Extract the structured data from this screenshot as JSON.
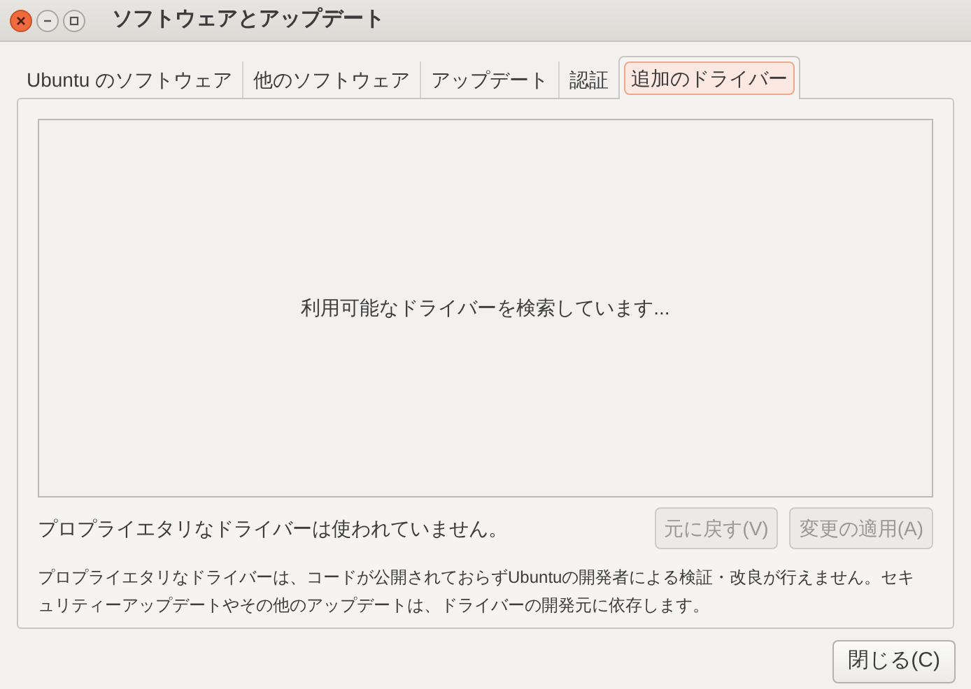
{
  "window": {
    "title": "ソフトウェアとアップデート"
  },
  "tabs": [
    {
      "label": "Ubuntu のソフトウェア",
      "selected": false
    },
    {
      "label": "他のソフトウェア",
      "selected": false
    },
    {
      "label": "アップデート",
      "selected": false
    },
    {
      "label": "認証",
      "selected": false
    },
    {
      "label": "追加のドライバー",
      "selected": true
    }
  ],
  "driver_list": {
    "message": "利用可能なドライバーを検索しています..."
  },
  "status": "プロプライエタリなドライバーは使われていません。",
  "buttons": [
    {
      "label": "元に戻す(V)",
      "disabled": true
    },
    {
      "label": "変更の適用(A)",
      "disabled": true
    }
  ],
  "description": "プロプライエタリなドライバーは、コードが公開されておらずUbuntuの開発者による検証・改良が行えません。セキュリティーアップデートやその他のアップデートは、ドライバーの開発元に依存します。",
  "close_button": {
    "label": "閉じる(C)"
  }
}
